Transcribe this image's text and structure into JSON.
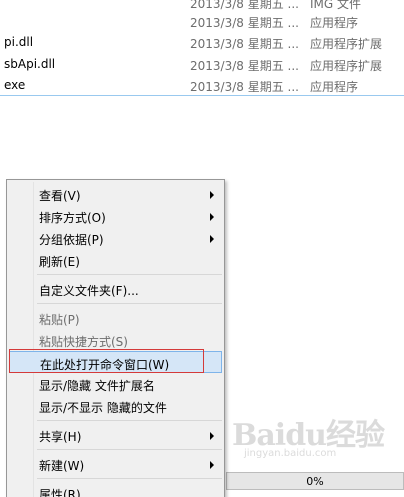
{
  "files": [
    {
      "name": "",
      "date": "2013/3/8 星期五 ...",
      "type": "IMG 文件",
      "cut": true
    },
    {
      "name": "",
      "date": "2013/3/8 星期五 ...",
      "type": "应用程序"
    },
    {
      "name": "pi.dll",
      "date": "2013/3/8 星期五 ...",
      "type": "应用程序扩展"
    },
    {
      "name": "sbApi.dll",
      "date": "2013/3/8 星期五 ...",
      "type": "应用程序扩展"
    },
    {
      "name": "exe",
      "date": "2013/3/8 星期五 ...",
      "type": "应用程序",
      "selected": true
    }
  ],
  "menu": {
    "view": "查看(V)",
    "sort": "排序方式(O)",
    "group": "分组依据(P)",
    "refresh": "刷新(E)",
    "customize": "自定义文件夹(F)...",
    "paste": "粘贴(P)",
    "paste_shortcut": "粘贴快捷方式(S)",
    "open_cmd": "在此处打开命令窗口(W)",
    "toggle_ext": "显示/隐藏 文件扩展名",
    "toggle_hidden": "显示/不显示 隐藏的文件",
    "share": "共享(H)",
    "new": "新建(W)",
    "properties": "属性(R)"
  },
  "progress": {
    "label": "0%",
    "value": 0
  },
  "watermark": {
    "text": "Baidu经验",
    "sub": "jingyan.baidu.com"
  },
  "colors": {
    "highlight": "#d5e6f7",
    "highlight_border": "#7eb4ea",
    "annotation": "#d43a3a",
    "selection_line": "#99c9ef"
  }
}
